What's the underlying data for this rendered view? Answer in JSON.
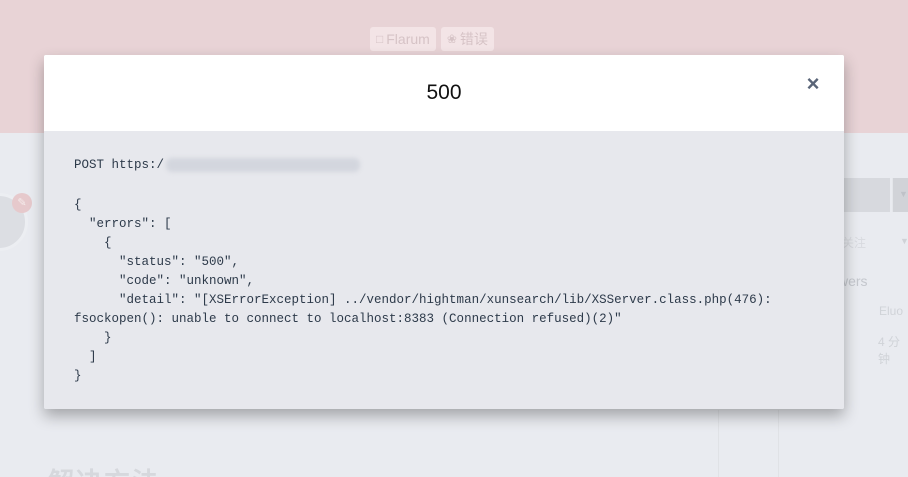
{
  "background": {
    "tags": [
      {
        "icon": "comment-icon",
        "label": "Flarum"
      },
      {
        "icon": "bug-icon",
        "label": "错误"
      }
    ],
    "sidebar": {
      "follow_label": "关注",
      "followers_label": "wers",
      "user_name": "Eluo",
      "time": "4 分钟"
    },
    "page_heading": "解决方法"
  },
  "modal": {
    "title": "500",
    "close_icon": "×",
    "request_prefix": "POST https:/",
    "response_body": "{\n  \"errors\": [\n    {\n      \"status\": \"500\",\n      \"code\": \"unknown\",\n      \"detail\": \"[XSErrorException] ../vendor/hightman/xunsearch/lib/XSServer.class.php(476):\nfsockopen(): unable to connect to localhost:8383 (Connection refused)(2)\"\n    }\n  ]\n}"
  },
  "colors": {
    "hero_bg": "#e8d3d6",
    "page_bg": "#e9ebf0",
    "modal_body_bg": "#e7e8ed",
    "code_text": "#2d3a4a"
  }
}
